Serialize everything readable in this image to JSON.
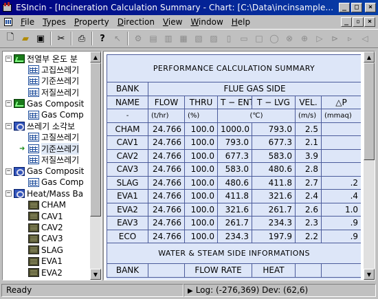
{
  "window": {
    "title": "ESIncin - [Incineration Calculation Summary - Chart: [C:\\Data\\incinsample..."
  },
  "menu": {
    "items": [
      {
        "acc": "F",
        "rest": "ile"
      },
      {
        "acc": "T",
        "rest": "ypes"
      },
      {
        "acc": "P",
        "rest": "roperty"
      },
      {
        "acc": "D",
        "rest": "irection"
      },
      {
        "acc": "V",
        "rest": "iew"
      },
      {
        "acc": "W",
        "rest": "indow"
      },
      {
        "acc": "H",
        "rest": "elp"
      }
    ]
  },
  "toolbar": {
    "icons": [
      "new-file-icon",
      "open-folder-icon",
      "save-icon",
      "cut-icon",
      "print-icon",
      "help-icon",
      "pointer-icon",
      "component-icon"
    ]
  },
  "tree": {
    "items": [
      {
        "label": "전열부 온도 분",
        "icon": "chart",
        "level": 0,
        "expander": "−"
      },
      {
        "label": "고집쓰레기",
        "icon": "table",
        "level": 1
      },
      {
        "label": "기준쓰레기",
        "icon": "table",
        "level": 1
      },
      {
        "label": "저질쓰레기",
        "icon": "table",
        "level": 1
      },
      {
        "label": "Gas Composit",
        "icon": "chart",
        "level": 0,
        "expander": "−"
      },
      {
        "label": "Gas Comp",
        "icon": "table",
        "level": 1
      },
      {
        "label": "쓰레기 소각보",
        "icon": "loop",
        "level": 0,
        "expander": "−"
      },
      {
        "label": "고질쓰레기",
        "icon": "table",
        "level": 1
      },
      {
        "label": "기준쓰레기",
        "icon": "table",
        "level": 1,
        "selected": true,
        "marker": "arrow"
      },
      {
        "label": "저질쓰레기",
        "icon": "table",
        "level": 1
      },
      {
        "label": "Gas Composit",
        "icon": "loop",
        "level": 0,
        "expander": "−"
      },
      {
        "label": "Gas Comp",
        "icon": "table",
        "level": 1
      },
      {
        "label": "Heat/Mass Ba",
        "icon": "loop",
        "level": 0,
        "expander": "−"
      },
      {
        "label": "CHAM",
        "icon": "file",
        "level": 1
      },
      {
        "label": "CAV1",
        "icon": "file",
        "level": 1
      },
      {
        "label": "CAV2",
        "icon": "file",
        "level": 1
      },
      {
        "label": "CAV3",
        "icon": "file",
        "level": 1
      },
      {
        "label": "SLAG",
        "icon": "file",
        "level": 1
      },
      {
        "label": "EVA1",
        "icon": "file",
        "level": 1
      },
      {
        "label": "EVA2",
        "icon": "file",
        "level": 1
      }
    ]
  },
  "report": {
    "title": "PERFORMANCE  CALCULATION  SUMMARY",
    "bank_label": "BANK",
    "flue_gas_label": "FLUE GAS SIDE",
    "col_headers": [
      "NAME",
      "FLOW",
      "THRU",
      "T − ENT",
      "T − LVG",
      "VEL.",
      "△P"
    ],
    "units": [
      "-",
      "(t/hr)",
      "(%)",
      "(℃)",
      "(m/s)",
      "(mmaq)"
    ],
    "rows": [
      {
        "name": "CHAM",
        "flow": "24.766",
        "thru": "100.0",
        "tent": "1000.0",
        "tlvg": "793.0",
        "vel": "2.5",
        "dp": ""
      },
      {
        "name": "CAV1",
        "flow": "24.766",
        "thru": "100.0",
        "tent": "793.0",
        "tlvg": "677.3",
        "vel": "2.1",
        "dp": ""
      },
      {
        "name": "CAV2",
        "flow": "24.766",
        "thru": "100.0",
        "tent": "677.3",
        "tlvg": "583.0",
        "vel": "3.9",
        "dp": ""
      },
      {
        "name": "CAV3",
        "flow": "24.766",
        "thru": "100.0",
        "tent": "583.0",
        "tlvg": "480.6",
        "vel": "2.8",
        "dp": ""
      },
      {
        "name": "SLAG",
        "flow": "24.766",
        "thru": "100.0",
        "tent": "480.6",
        "tlvg": "411.8",
        "vel": "2.7",
        "dp": ".2"
      },
      {
        "name": "EVA1",
        "flow": "24.766",
        "thru": "100.0",
        "tent": "411.8",
        "tlvg": "321.6",
        "vel": "2.4",
        "dp": ".4"
      },
      {
        "name": "EVA2",
        "flow": "24.766",
        "thru": "100.0",
        "tent": "321.6",
        "tlvg": "261.7",
        "vel": "2.6",
        "dp": "1.0"
      },
      {
        "name": "EAV3",
        "flow": "24.766",
        "thru": "100.0",
        "tent": "261.7",
        "tlvg": "234.3",
        "vel": "2.3",
        "dp": ".9"
      },
      {
        "name": "ECO",
        "flow": "24.766",
        "thru": "100.0",
        "tent": "234.3",
        "tlvg": "197.9",
        "vel": "2.2",
        "dp": ".9"
      }
    ],
    "water_title": "WATER & STEAM  SIDE  INFORMATIONS",
    "water_headers": {
      "bank": "BANK",
      "flow_rate": "FLOW RATE",
      "heat": "HEAT"
    }
  },
  "status": {
    "ready": "Ready",
    "log": "Log: (-276,369)  Dev: (62,6)"
  },
  "colors": {
    "title_bar": "#000080",
    "report_bg": "#dde6f8",
    "grid_line": "#4a5a9a"
  }
}
